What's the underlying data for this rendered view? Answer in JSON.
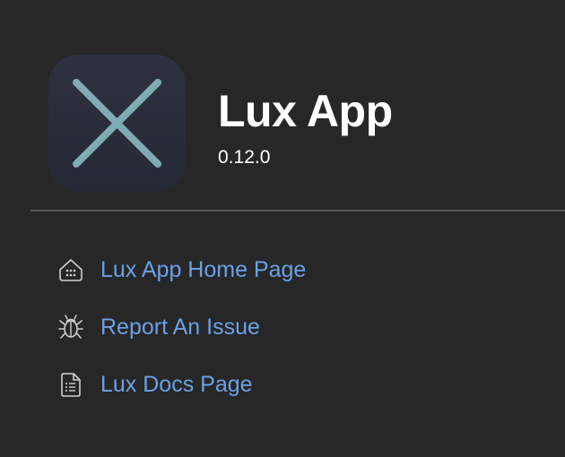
{
  "app": {
    "name": "Lux App",
    "version": "0.12.0"
  },
  "links": [
    {
      "label": "Lux App Home Page",
      "icon": "home-icon"
    },
    {
      "label": "Report An Issue",
      "icon": "bug-icon"
    },
    {
      "label": "Lux Docs Page",
      "icon": "document-icon"
    }
  ],
  "colors": {
    "background": "#272727",
    "link": "#6aa1e6",
    "icon_tile": "#2b2f3c",
    "icon_glyph": "#7fabb5",
    "divider": "#55565a"
  }
}
